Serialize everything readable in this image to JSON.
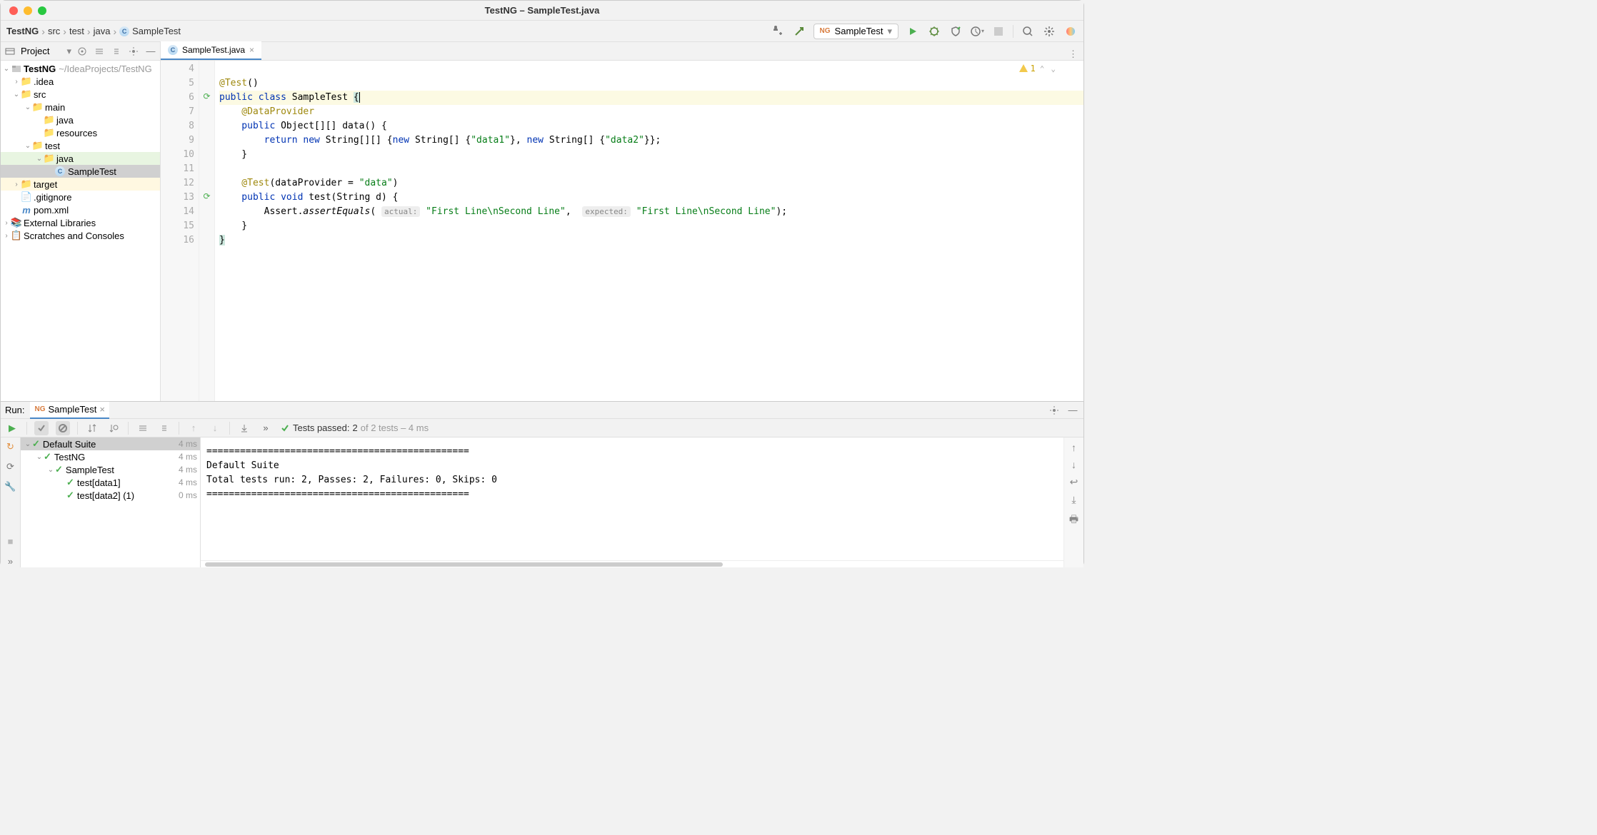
{
  "window": {
    "title": "TestNG – SampleTest.java"
  },
  "breadcrumbs": [
    "TestNG",
    "src",
    "test",
    "java",
    "SampleTest"
  ],
  "runConfig": "SampleTest",
  "sidebar": {
    "title": "Project",
    "tree": {
      "root": "TestNG",
      "rootPath": "~/IdeaProjects/TestNG",
      "items": [
        ".idea",
        "src",
        "main",
        "java",
        "resources",
        "test",
        "java",
        "SampleTest",
        "target",
        ".gitignore",
        "pom.xml"
      ],
      "extLib": "External Libraries",
      "scratches": "Scratches and Consoles"
    }
  },
  "tab": {
    "name": "SampleTest.java"
  },
  "warnings": "1",
  "code": {
    "lines": [
      4,
      5,
      6,
      7,
      8,
      9,
      10,
      11,
      12,
      13,
      14,
      15,
      16
    ],
    "l5_ann": "@Test",
    "l5_paren": "()",
    "l6_pub": "public ",
    "l6_class": "class ",
    "l6_name": "SampleTest ",
    "l6_brace": "{",
    "l7": "    @DataProvider",
    "l8_pub": "    public ",
    "l8_rest": "Object[][] ",
    "l8_name": "data",
    "l8_end": "() {",
    "l9_ret": "        return ",
    "l9_new1": "new ",
    "l9_a": "String[][] {",
    "l9_new2": "new ",
    "l9_b": "String[] {",
    "l9_s1": "\"data1\"",
    "l9_c": "}, ",
    "l9_new3": "new ",
    "l9_d": "String[] {",
    "l9_s2": "\"data2\"",
    "l9_e": "}};",
    "l10": "    }",
    "l12_ann": "    @Test",
    "l12_rest": "(dataProvider = ",
    "l12_str": "\"data\"",
    "l12_end": ")",
    "l13_pub": "    public ",
    "l13_void": "void ",
    "l13_name": "test",
    "l13_args": "(String ",
    "l13_p": "d",
    "l13_end": ") {",
    "l14_a": "        Assert.",
    "l14_b": "assertEquals",
    "l14_c": "( ",
    "l14_h1": "actual:",
    "l14_d": " ",
    "l14_s1": "\"First Line\\nSecond Line\"",
    "l14_e": ",  ",
    "l14_h2": "expected:",
    "l14_f": " ",
    "l14_s2": "\"First Line\\nSecond Line\"",
    "l14_g": ");",
    "l15": "    }",
    "l16": "}"
  },
  "run": {
    "label": "Run:",
    "tab": "SampleTest",
    "passed_prefix": "Tests passed: ",
    "passed_count": "2",
    "passed_suffix": " of 2 tests – 4 ms",
    "tree": [
      {
        "name": "Default Suite",
        "time": "4 ms",
        "indent": 0,
        "arrow": true
      },
      {
        "name": "TestNG",
        "time": "4 ms",
        "indent": 1,
        "arrow": true
      },
      {
        "name": "SampleTest",
        "time": "4 ms",
        "indent": 2,
        "arrow": true
      },
      {
        "name": "test[data1]",
        "time": "4 ms",
        "indent": 3,
        "arrow": false
      },
      {
        "name": "test[data2] (1)",
        "time": "0 ms",
        "indent": 3,
        "arrow": false
      }
    ],
    "console": [
      "===============================================",
      "Default Suite",
      "Total tests run: 2, Passes: 2, Failures: 0, Skips: 0",
      "==============================================="
    ]
  }
}
